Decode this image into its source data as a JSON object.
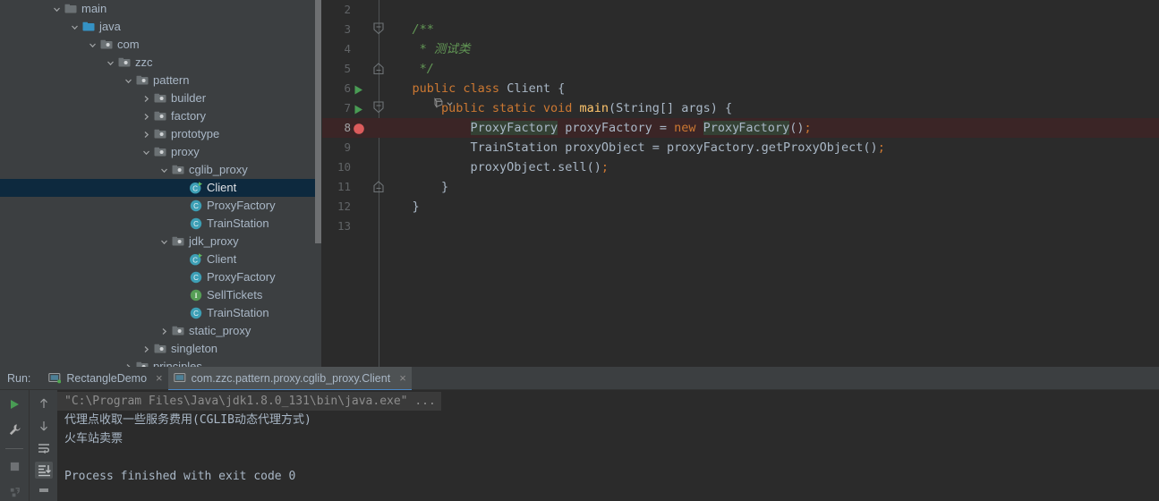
{
  "tree": {
    "rows": [
      {
        "depth": 2,
        "arrow": "down",
        "icon": "folder-gray",
        "label": "main",
        "selected": false
      },
      {
        "depth": 3,
        "arrow": "down",
        "icon": "folder-blue",
        "label": "java",
        "selected": false
      },
      {
        "depth": 4,
        "arrow": "down",
        "icon": "package",
        "label": "com",
        "selected": false
      },
      {
        "depth": 5,
        "arrow": "down",
        "icon": "package",
        "label": "zzc",
        "selected": false
      },
      {
        "depth": 6,
        "arrow": "down",
        "icon": "package",
        "label": "pattern",
        "selected": false
      },
      {
        "depth": 7,
        "arrow": "right",
        "icon": "package",
        "label": "builder",
        "selected": false
      },
      {
        "depth": 7,
        "arrow": "right",
        "icon": "package",
        "label": "factory",
        "selected": false
      },
      {
        "depth": 7,
        "arrow": "right",
        "icon": "package",
        "label": "prototype",
        "selected": false
      },
      {
        "depth": 7,
        "arrow": "down",
        "icon": "package",
        "label": "proxy",
        "selected": false
      },
      {
        "depth": 8,
        "arrow": "down",
        "icon": "package",
        "label": "cglib_proxy",
        "selected": false
      },
      {
        "depth": 9,
        "arrow": "none",
        "icon": "class-run",
        "label": "Client",
        "selected": true
      },
      {
        "depth": 9,
        "arrow": "none",
        "icon": "class",
        "label": "ProxyFactory",
        "selected": false
      },
      {
        "depth": 9,
        "arrow": "none",
        "icon": "class",
        "label": "TrainStation",
        "selected": false
      },
      {
        "depth": 8,
        "arrow": "down",
        "icon": "package",
        "label": "jdk_proxy",
        "selected": false
      },
      {
        "depth": 9,
        "arrow": "none",
        "icon": "class-run",
        "label": "Client",
        "selected": false
      },
      {
        "depth": 9,
        "arrow": "none",
        "icon": "class",
        "label": "ProxyFactory",
        "selected": false
      },
      {
        "depth": 9,
        "arrow": "none",
        "icon": "interface",
        "label": "SellTickets",
        "selected": false
      },
      {
        "depth": 9,
        "arrow": "none",
        "icon": "class",
        "label": "TrainStation",
        "selected": false
      },
      {
        "depth": 8,
        "arrow": "right",
        "icon": "package",
        "label": "static_proxy",
        "selected": false
      },
      {
        "depth": 7,
        "arrow": "right",
        "icon": "package",
        "label": "singleton",
        "selected": false
      },
      {
        "depth": 6,
        "arrow": "right",
        "icon": "package",
        "label": "principles",
        "selected": false
      }
    ]
  },
  "editor": {
    "lines": [
      {
        "num": "2",
        "gutter": "none",
        "fold": "none",
        "highlight": false,
        "tokens": []
      },
      {
        "num": "3",
        "gutter": "none",
        "fold": "open",
        "highlight": false,
        "tokens": [
          {
            "t": "    ",
            "c": "txt"
          },
          {
            "t": "/**",
            "c": "cmt"
          }
        ]
      },
      {
        "num": "4",
        "gutter": "none",
        "fold": "none",
        "highlight": false,
        "tokens": [
          {
            "t": "     * 测试类",
            "c": "cmt"
          }
        ]
      },
      {
        "num": "5",
        "gutter": "none",
        "fold": "close",
        "highlight": false,
        "tokens": [
          {
            "t": "     */",
            "c": "cmt"
          }
        ]
      },
      {
        "num": "6",
        "gutter": "run",
        "fold": "none",
        "highlight": false,
        "tokens": [
          {
            "t": "    ",
            "c": "txt"
          },
          {
            "t": "public class ",
            "c": "kw"
          },
          {
            "t": "Client ",
            "c": "cls"
          },
          {
            "t": "{",
            "c": "txt"
          }
        ]
      },
      {
        "num": "7",
        "gutter": "run",
        "fold": "open",
        "highlight": false,
        "tokens": [
          {
            "t": "        ",
            "c": "txt"
          },
          {
            "t": "public static void ",
            "c": "kw"
          },
          {
            "t": "main",
            "c": "fn"
          },
          {
            "t": "(String[] args) {",
            "c": "txt"
          }
        ]
      },
      {
        "num": "8",
        "gutter": "breakpoint",
        "fold": "none",
        "highlight": true,
        "tokens": [
          {
            "t": "            ",
            "c": "txt"
          },
          {
            "t": "ProxyFactory",
            "c": "txt hi-id"
          },
          {
            "t": " proxyFactory = ",
            "c": "txt"
          },
          {
            "t": "new ",
            "c": "kw"
          },
          {
            "t": "Proxy",
            "c": "txt hi-id"
          },
          {
            "t": "CARET",
            "c": "caret"
          },
          {
            "t": "Factory",
            "c": "txt hi-id"
          },
          {
            "t": "()",
            "c": "txt"
          },
          {
            "t": ";",
            "c": "sc"
          }
        ]
      },
      {
        "num": "9",
        "gutter": "none",
        "fold": "none",
        "highlight": false,
        "tokens": [
          {
            "t": "            TrainStation proxyObject = proxyFactory.getProxyObject()",
            "c": "txt"
          },
          {
            "t": ";",
            "c": "sc"
          }
        ]
      },
      {
        "num": "10",
        "gutter": "none",
        "fold": "none",
        "highlight": false,
        "tokens": [
          {
            "t": "            proxyObject.sell()",
            "c": "txt"
          },
          {
            "t": ";",
            "c": "sc"
          }
        ]
      },
      {
        "num": "11",
        "gutter": "none",
        "fold": "close",
        "highlight": false,
        "tokens": [
          {
            "t": "        }",
            "c": "txt"
          }
        ]
      },
      {
        "num": "12",
        "gutter": "none",
        "fold": "none",
        "highlight": false,
        "tokens": [
          {
            "t": "    }",
            "c": "txt"
          }
        ]
      },
      {
        "num": "13",
        "gutter": "none",
        "fold": "none",
        "highlight": false,
        "tokens": []
      }
    ]
  },
  "run": {
    "label": "Run:",
    "tabs": [
      {
        "title": "RectangleDemo",
        "icon": "monitor-running",
        "active": false,
        "close": "×"
      },
      {
        "title": "com.zzc.pattern.proxy.cglib_proxy.Client",
        "icon": "monitor",
        "active": true,
        "close": "×"
      }
    ],
    "tools_left": [
      "run-icon",
      "wrench-icon",
      "divider",
      "stop-icon",
      "rerun-icon"
    ],
    "tools_right": [
      "arrow-up-icon",
      "arrow-down-icon",
      "soft-wrap-icon",
      "scroll-to-end-icon",
      "print-icon"
    ],
    "console": [
      {
        "text": "\"C:\\Program Files\\Java\\jdk1.8.0_131\\bin\\java.exe\" ...",
        "folded": true
      },
      {
        "text": "代理点收取一些服务费用(CGLIB动态代理方式)",
        "folded": false
      },
      {
        "text": "火车站卖票",
        "folded": false
      },
      {
        "text": "",
        "folded": false
      },
      {
        "text": "Process finished with exit code 0",
        "folded": false
      }
    ]
  },
  "colors": {
    "panel_bg": "#3c3f41",
    "editor_bg": "#2b2b2b",
    "selection_blue": "#0d293e",
    "accent_blue": "#4a88c7",
    "breakpoint_red": "#db5c5c",
    "line_highlight": "#3b2526",
    "run_green": "#499c54",
    "text": "#a9b7c6"
  }
}
